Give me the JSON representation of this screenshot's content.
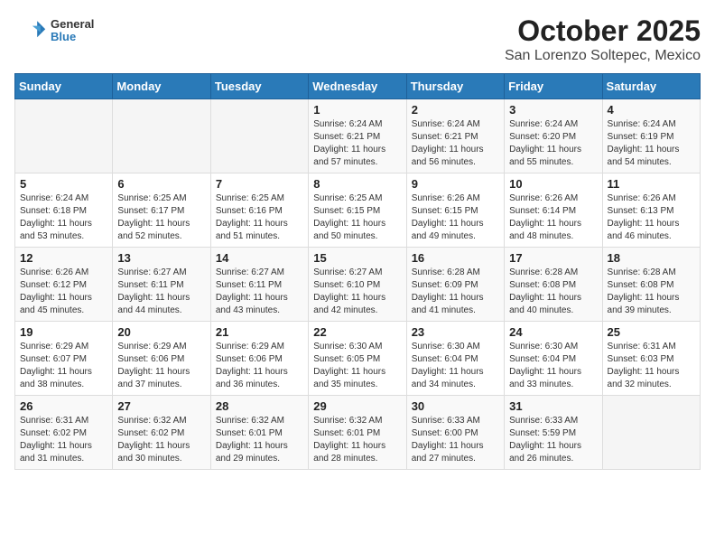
{
  "header": {
    "logo_line1": "General",
    "logo_line2": "Blue",
    "title": "October 2025",
    "subtitle": "San Lorenzo Soltepec, Mexico"
  },
  "days_of_week": [
    "Sunday",
    "Monday",
    "Tuesday",
    "Wednesday",
    "Thursday",
    "Friday",
    "Saturday"
  ],
  "weeks": [
    [
      {
        "day": "",
        "info": ""
      },
      {
        "day": "",
        "info": ""
      },
      {
        "day": "",
        "info": ""
      },
      {
        "day": "1",
        "info": "Sunrise: 6:24 AM\nSunset: 6:21 PM\nDaylight: 11 hours and 57 minutes."
      },
      {
        "day": "2",
        "info": "Sunrise: 6:24 AM\nSunset: 6:21 PM\nDaylight: 11 hours and 56 minutes."
      },
      {
        "day": "3",
        "info": "Sunrise: 6:24 AM\nSunset: 6:20 PM\nDaylight: 11 hours and 55 minutes."
      },
      {
        "day": "4",
        "info": "Sunrise: 6:24 AM\nSunset: 6:19 PM\nDaylight: 11 hours and 54 minutes."
      }
    ],
    [
      {
        "day": "5",
        "info": "Sunrise: 6:24 AM\nSunset: 6:18 PM\nDaylight: 11 hours and 53 minutes."
      },
      {
        "day": "6",
        "info": "Sunrise: 6:25 AM\nSunset: 6:17 PM\nDaylight: 11 hours and 52 minutes."
      },
      {
        "day": "7",
        "info": "Sunrise: 6:25 AM\nSunset: 6:16 PM\nDaylight: 11 hours and 51 minutes."
      },
      {
        "day": "8",
        "info": "Sunrise: 6:25 AM\nSunset: 6:15 PM\nDaylight: 11 hours and 50 minutes."
      },
      {
        "day": "9",
        "info": "Sunrise: 6:26 AM\nSunset: 6:15 PM\nDaylight: 11 hours and 49 minutes."
      },
      {
        "day": "10",
        "info": "Sunrise: 6:26 AM\nSunset: 6:14 PM\nDaylight: 11 hours and 48 minutes."
      },
      {
        "day": "11",
        "info": "Sunrise: 6:26 AM\nSunset: 6:13 PM\nDaylight: 11 hours and 46 minutes."
      }
    ],
    [
      {
        "day": "12",
        "info": "Sunrise: 6:26 AM\nSunset: 6:12 PM\nDaylight: 11 hours and 45 minutes."
      },
      {
        "day": "13",
        "info": "Sunrise: 6:27 AM\nSunset: 6:11 PM\nDaylight: 11 hours and 44 minutes."
      },
      {
        "day": "14",
        "info": "Sunrise: 6:27 AM\nSunset: 6:11 PM\nDaylight: 11 hours and 43 minutes."
      },
      {
        "day": "15",
        "info": "Sunrise: 6:27 AM\nSunset: 6:10 PM\nDaylight: 11 hours and 42 minutes."
      },
      {
        "day": "16",
        "info": "Sunrise: 6:28 AM\nSunset: 6:09 PM\nDaylight: 11 hours and 41 minutes."
      },
      {
        "day": "17",
        "info": "Sunrise: 6:28 AM\nSunset: 6:08 PM\nDaylight: 11 hours and 40 minutes."
      },
      {
        "day": "18",
        "info": "Sunrise: 6:28 AM\nSunset: 6:08 PM\nDaylight: 11 hours and 39 minutes."
      }
    ],
    [
      {
        "day": "19",
        "info": "Sunrise: 6:29 AM\nSunset: 6:07 PM\nDaylight: 11 hours and 38 minutes."
      },
      {
        "day": "20",
        "info": "Sunrise: 6:29 AM\nSunset: 6:06 PM\nDaylight: 11 hours and 37 minutes."
      },
      {
        "day": "21",
        "info": "Sunrise: 6:29 AM\nSunset: 6:06 PM\nDaylight: 11 hours and 36 minutes."
      },
      {
        "day": "22",
        "info": "Sunrise: 6:30 AM\nSunset: 6:05 PM\nDaylight: 11 hours and 35 minutes."
      },
      {
        "day": "23",
        "info": "Sunrise: 6:30 AM\nSunset: 6:04 PM\nDaylight: 11 hours and 34 minutes."
      },
      {
        "day": "24",
        "info": "Sunrise: 6:30 AM\nSunset: 6:04 PM\nDaylight: 11 hours and 33 minutes."
      },
      {
        "day": "25",
        "info": "Sunrise: 6:31 AM\nSunset: 6:03 PM\nDaylight: 11 hours and 32 minutes."
      }
    ],
    [
      {
        "day": "26",
        "info": "Sunrise: 6:31 AM\nSunset: 6:02 PM\nDaylight: 11 hours and 31 minutes."
      },
      {
        "day": "27",
        "info": "Sunrise: 6:32 AM\nSunset: 6:02 PM\nDaylight: 11 hours and 30 minutes."
      },
      {
        "day": "28",
        "info": "Sunrise: 6:32 AM\nSunset: 6:01 PM\nDaylight: 11 hours and 29 minutes."
      },
      {
        "day": "29",
        "info": "Sunrise: 6:32 AM\nSunset: 6:01 PM\nDaylight: 11 hours and 28 minutes."
      },
      {
        "day": "30",
        "info": "Sunrise: 6:33 AM\nSunset: 6:00 PM\nDaylight: 11 hours and 27 minutes."
      },
      {
        "day": "31",
        "info": "Sunrise: 6:33 AM\nSunset: 5:59 PM\nDaylight: 11 hours and 26 minutes."
      },
      {
        "day": "",
        "info": ""
      }
    ]
  ]
}
